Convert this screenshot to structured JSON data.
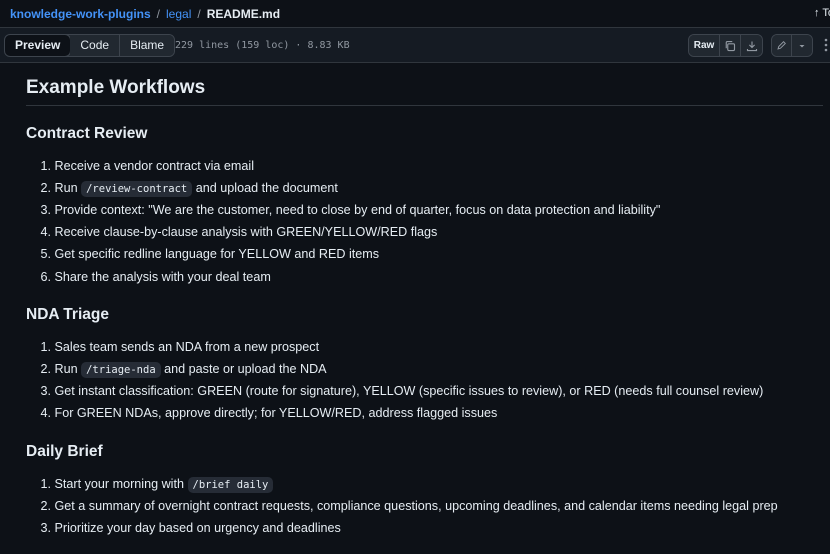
{
  "breadcrumb": {
    "repo": "knowledge-work-plugins",
    "sep1": "/",
    "folder": "legal",
    "sep2": "/",
    "file": "README.md",
    "right_text": "↑ To"
  },
  "toolbar": {
    "tabs": [
      "Preview",
      "Code",
      "Blame"
    ],
    "active_tab": "Preview",
    "file_meta": "229 lines (159 loc) · 8.83 KB",
    "raw_label": "Raw"
  },
  "doc": {
    "h1": "Example Workflows",
    "sections": [
      {
        "title": "Contract Review",
        "items": [
          {
            "num": "1.",
            "pre": "Receive a vendor contract via email",
            "code": "",
            "post": ""
          },
          {
            "num": "2.",
            "pre": "Run ",
            "code": "/review-contract",
            "post": " and upload the document"
          },
          {
            "num": "3.",
            "pre": "Provide context: \"We are the customer, need to close by end of quarter, focus on data protection and liability\"",
            "code": "",
            "post": ""
          },
          {
            "num": "4.",
            "pre": "Receive clause-by-clause analysis with GREEN/YELLOW/RED flags",
            "code": "",
            "post": ""
          },
          {
            "num": "5.",
            "pre": "Get specific redline language for YELLOW and RED items",
            "code": "",
            "post": ""
          },
          {
            "num": "6.",
            "pre": "Share the analysis with your deal team",
            "code": "",
            "post": ""
          }
        ]
      },
      {
        "title": "NDA Triage",
        "items": [
          {
            "num": "1.",
            "pre": "Sales team sends an NDA from a new prospect",
            "code": "",
            "post": ""
          },
          {
            "num": "2.",
            "pre": "Run ",
            "code": "/triage-nda",
            "post": " and paste or upload the NDA"
          },
          {
            "num": "3.",
            "pre": "Get instant classification: GREEN (route for signature), YELLOW (specific issues to review), or RED (needs full counsel review)",
            "code": "",
            "post": ""
          },
          {
            "num": "4.",
            "pre": "For GREEN NDAs, approve directly; for YELLOW/RED, address flagged issues",
            "code": "",
            "post": ""
          }
        ]
      },
      {
        "title": "Daily Brief",
        "items": [
          {
            "num": "1.",
            "pre": "Start your morning with ",
            "code": "/brief daily",
            "post": ""
          },
          {
            "num": "2.",
            "pre": "Get a summary of overnight contract requests, compliance questions, upcoming deadlines, and calendar items needing legal prep",
            "code": "",
            "post": ""
          },
          {
            "num": "3.",
            "pre": "Prioritize your day based on urgency and deadlines",
            "code": "",
            "post": ""
          }
        ]
      }
    ]
  }
}
